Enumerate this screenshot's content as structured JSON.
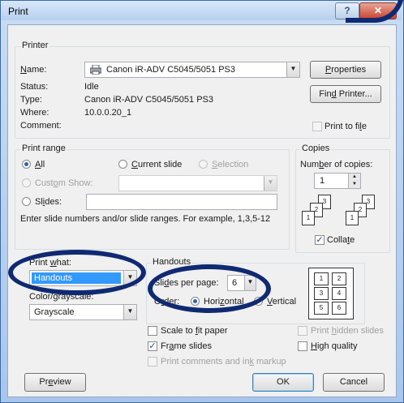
{
  "window": {
    "title": "Print",
    "help_glyph": "?",
    "close_glyph": "✕"
  },
  "printer": {
    "group_label": "Printer",
    "name_label": "Name:",
    "name_value": "Canon iR-ADV C5045/5051 PS3",
    "status_label": "Status:",
    "status_value": "Idle",
    "type_label": "Type:",
    "type_value": "Canon iR-ADV C5045/5051 PS3",
    "where_label": "Where:",
    "where_value": "10.0.0.20_1",
    "comment_label": "Comment:",
    "properties_label": "Properties",
    "find_printer_label": "Find Printer...",
    "print_to_file_label": "Print to file"
  },
  "print_range": {
    "group_label": "Print range",
    "all_label": "All",
    "current_slide_label": "Current slide",
    "selection_label": "Selection",
    "custom_show_label": "Custom Show:",
    "slides_label": "Slides:",
    "hint": "Enter slide numbers and/or slide ranges. For example, 1,3,5-12"
  },
  "copies": {
    "group_label": "Copies",
    "number_label": "Number of copies:",
    "number_value": "1",
    "collate_label": "Collate",
    "collate_pages": [
      "1",
      "2",
      "3"
    ]
  },
  "print_what": {
    "label": "Print what:",
    "value": "Handouts"
  },
  "color": {
    "label": "Color/grayscale:",
    "value": "Grayscale"
  },
  "handouts": {
    "group_label": "Handouts",
    "slides_per_page_label": "Slides per page:",
    "slides_per_page_value": "6",
    "order_label": "Order:",
    "horizontal_label": "Horizontal",
    "vertical_label": "Vertical",
    "preview_cells": [
      "1",
      "2",
      "3",
      "4",
      "5",
      "6"
    ]
  },
  "options": {
    "scale_to_fit_label": "Scale to fit paper",
    "frame_slides_label": "Frame slides",
    "print_comments_label": "Print comments and ink markup",
    "print_hidden_label": "Print hidden slides",
    "high_quality_label": "High quality"
  },
  "footer": {
    "preview_label": "Preview",
    "ok_label": "OK",
    "cancel_label": "Cancel"
  },
  "colors": {
    "highlight": "#3399ff",
    "annotation": "#0f2a72"
  }
}
